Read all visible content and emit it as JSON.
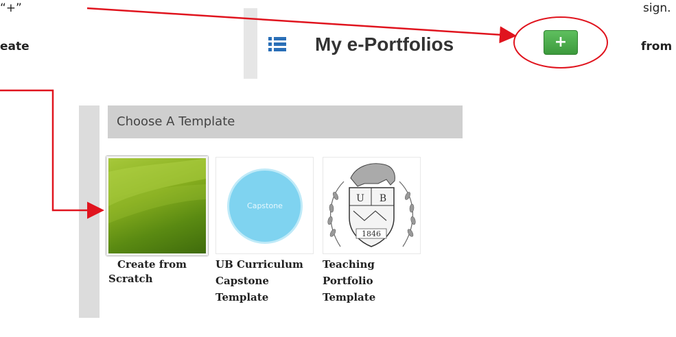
{
  "doc": {
    "top_left_text": "“+”",
    "left_bold_text": "eate",
    "right_top_text": "sign.",
    "right_bold_text": "from"
  },
  "header": {
    "title": "My e-Portfolios",
    "icon": "list-icon",
    "add_button_label": "+"
  },
  "chooser": {
    "title": "Choose A Template",
    "templates": [
      {
        "label_line1": "Create from",
        "label_line2": "Scratch",
        "label_line3": ""
      },
      {
        "label_line1": "UB Curriculum",
        "label_line2": "Capstone",
        "label_line3": "Template",
        "thumb_text": "Capstone"
      },
      {
        "label_line1": "Teaching",
        "label_line2": "Portfolio",
        "label_line3": "Template",
        "seal_year": "1846"
      }
    ]
  },
  "colors": {
    "annotation_red": "#e0141e",
    "add_button_green": "#4cae4c",
    "list_icon_blue": "#2a6fb7"
  }
}
